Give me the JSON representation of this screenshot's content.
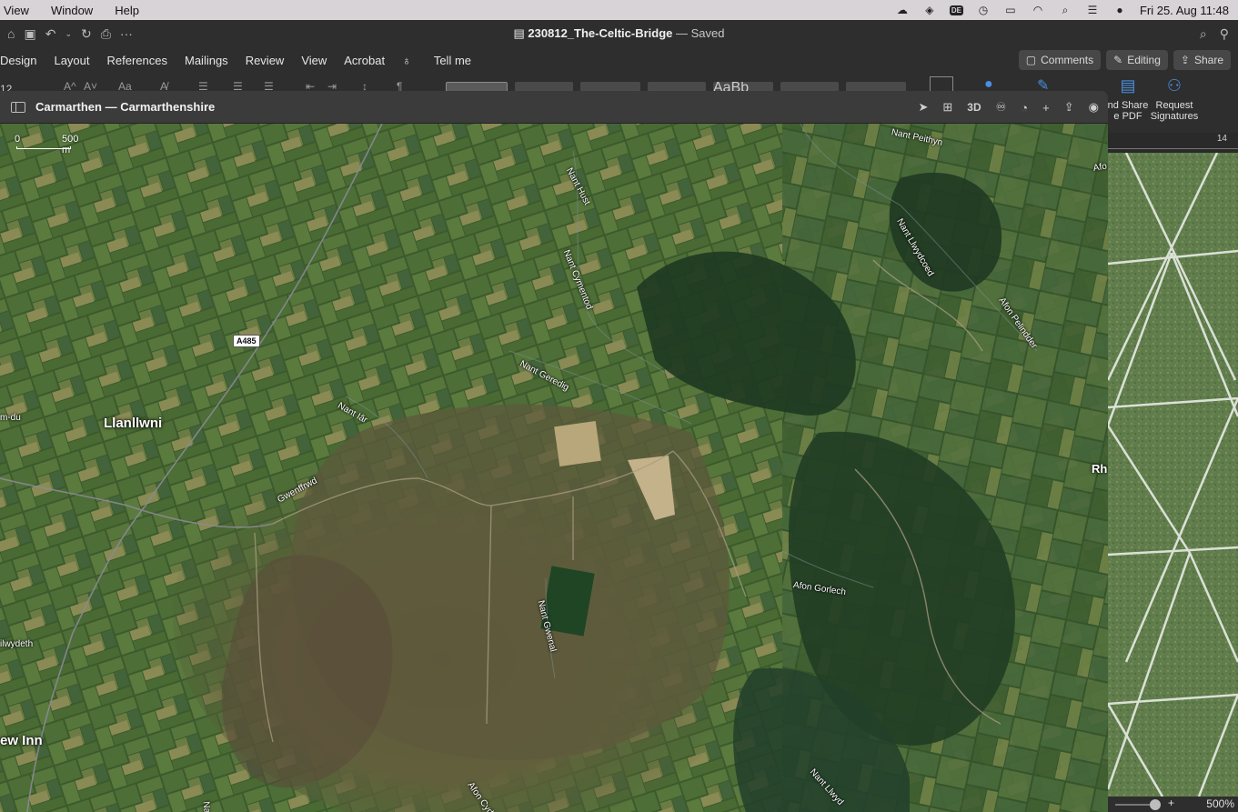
{
  "menubar": {
    "items": [
      "View",
      "Window",
      "Help"
    ],
    "clock": "Fri 25. Aug  11:48",
    "input_badge": "DE"
  },
  "word": {
    "doc_title": "230812_The-Celtic-Bridge",
    "save_status": "— Saved",
    "tabs": [
      "Design",
      "Layout",
      "References",
      "Mailings",
      "Review",
      "View",
      "Acrobat"
    ],
    "tell_me": "Tell me",
    "comments_btn": "Comments",
    "editing_btn": "Editing",
    "share_btn": "Share",
    "font_size": "12",
    "style_preview": "AaBb",
    "share_pdf_line1": "nd Share",
    "share_pdf_line2": "e PDF",
    "request_sig_line1": "Request",
    "request_sig_line2": "Signatures",
    "ruler_number": "14",
    "zoom_plus": "+",
    "zoom_percent": "500%"
  },
  "maps": {
    "window_title": "Carmarthen — Carmarthenshire",
    "tool_3d": "3D",
    "scale_zero": "0",
    "scale_distance": "500 m",
    "road_shield": "A485",
    "towns": {
      "llanllwni": "Llanllwni",
      "new_inn": "ew Inn",
      "rh": "Rh",
      "m_du": "m-du",
      "ilwydeth": "ilwydeth"
    },
    "streams": {
      "nant_peithyn": "Nant Peithyn",
      "nant_hust": "Nant Hust",
      "nant_cymentod": "Nant Cymentod",
      "nant_llwydcoed": "Nant Llwydcoed",
      "afon_pelindder": "Afon Pelindder",
      "nant_geredig": "Nant Geredig",
      "nant_iar": "Nant Iâr",
      "gwenffrwd": "Gwenffrwd",
      "afon_gorlech": "Afon Gorlech",
      "nant_gwenal": "Nant Gwenal",
      "nant_llwyd": "Nant Llwyd",
      "afon_cyde": "Afon Cyde",
      "afo": "Afo",
      "nanc": "Nanc"
    }
  }
}
